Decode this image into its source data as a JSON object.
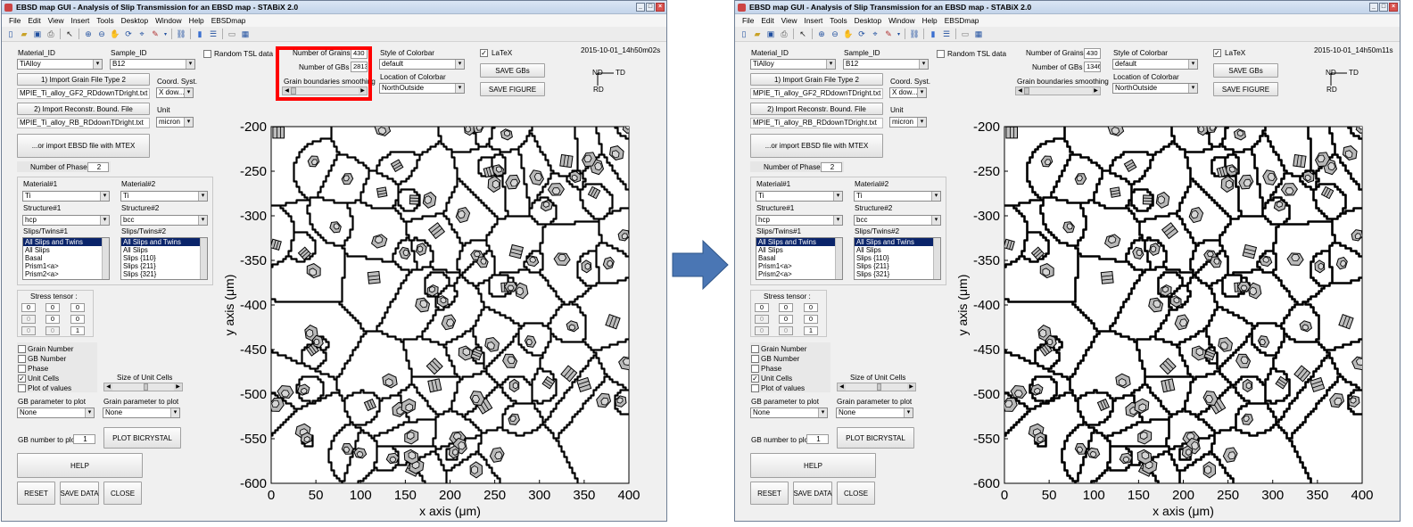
{
  "arrow_color": "#4a76b4",
  "highlight_color": "#ff0000",
  "windows": [
    {
      "title": "EBSD map GUI - Analysis of Slip Transmission for an EBSD map -  STABiX 2.0",
      "menu": [
        "File",
        "Edit",
        "View",
        "Insert",
        "Tools",
        "Desktop",
        "Window",
        "Help",
        "EBSDmap"
      ],
      "material_id_label": "Material_ID",
      "material_id_value": "TiAlloy",
      "sample_id_label": "Sample_ID",
      "sample_id_value": "B12",
      "random_tsl_label": "Random TSL data",
      "num_grains_label": "Number of Grains :",
      "num_grains_value": "430",
      "num_gbs_label": "Number of GBs :",
      "num_gbs_value": "2813",
      "gb_smoothing_label": "Grain boundaries smoothing",
      "colorbar_style_label": "Style of Colorbar",
      "colorbar_style_value": "default",
      "colorbar_location_label": "Location of Colorbar",
      "colorbar_location_value": "NorthOutside",
      "latex_label": "LaTeX",
      "save_gbs_label": "SAVE GBs",
      "save_figure_label": "SAVE FIGURE",
      "timestamp": "2015-10-01_14h50m02s",
      "import_grain_label": "1) Import Grain File Type 2",
      "grain_file": "MPIE_Ti_alloy_GF2_RDdownTDright.txt",
      "coord_syst_label": "Coord. Syst.",
      "coord_syst_value": "X dow...",
      "import_rb_label": "2) Import Reconstr. Bound. File",
      "rb_file": "MPIE_Ti_alloy_RB_RDdownTDright.txt",
      "unit_label": "Unit",
      "unit_value": "micron",
      "mtex_label": "...or import EBSD file with MTEX",
      "num_phases_label": "Number of Phases",
      "num_phases_value": "2",
      "material1_label": "Material#1",
      "material1_value": "Ti",
      "structure1_label": "Structure#1",
      "structure1_value": "hcp",
      "slips1_label": "Slips/Twins#1",
      "slips1_items": [
        "All Slips and Twins",
        "All Slips",
        "Basal",
        "Prism1<a>",
        "Prism2<a>"
      ],
      "material2_label": "Material#2",
      "material2_value": "Ti",
      "structure2_label": "Structure#2",
      "structure2_value": "bcc",
      "slips2_label": "Slips/Twins#2",
      "slips2_items": [
        "All Slips and Twins",
        "All Slips",
        "Slips {110}",
        "Slips {211}",
        "Slips {321}"
      ],
      "stress_label": "Stress tensor :",
      "stress_values": [
        "0",
        "0",
        "0",
        "0",
        "0",
        "0",
        "0",
        "0",
        "1"
      ],
      "check_grain_number": "Grain Number",
      "check_gb_number": "GB Number",
      "check_phase": "Phase",
      "check_unit_cells": "Unit Cells",
      "check_plot_values": "Plot of values",
      "unit_cells_size_label": "Size of Unit Cells",
      "gb_param_label": "GB parameter to plot",
      "gb_param_value": "None",
      "grain_param_label": "Grain parameter to plot",
      "grain_param_value": "None",
      "gb_number_plot_label": "GB number to plot",
      "gb_number_plot_value": "1",
      "plot_bicrystal_label": "PLOT BICRYSTAL",
      "help_label": "HELP",
      "reset_label": "RESET",
      "save_data_label": "SAVE DATA",
      "close_label": "CLOSE",
      "axis_nd": "ND",
      "axis_td": "TD",
      "axis_rd": "RD",
      "plot_ylabel": "y axis (μm)",
      "plot_xlabel": "x axis (μm)",
      "plot_yticks": [
        "-200",
        "-250",
        "-300",
        "-350",
        "-400",
        "-450",
        "-500",
        "-550",
        "-600"
      ],
      "plot_xticks": [
        "0",
        "50",
        "100",
        "150",
        "200",
        "250",
        "300",
        "350",
        "400"
      ]
    },
    {
      "title": "EBSD map GUI - Analysis of Slip Transmission for an EBSD map -  STABiX 2.0",
      "menu": [
        "File",
        "Edit",
        "View",
        "Insert",
        "Tools",
        "Desktop",
        "Window",
        "Help",
        "EBSDmap"
      ],
      "material_id_label": "Material_ID",
      "material_id_value": "TiAlloy",
      "sample_id_label": "Sample_ID",
      "sample_id_value": "B12",
      "random_tsl_label": "Random TSL data",
      "num_grains_label": "Number of Grains :",
      "num_grains_value": "430",
      "num_gbs_label": "Number of GBs :",
      "num_gbs_value": "1346",
      "gb_smoothing_label": "Grain boundaries smoothing",
      "colorbar_style_label": "Style of Colorbar",
      "colorbar_style_value": "default",
      "colorbar_location_label": "Location of Colorbar",
      "colorbar_location_value": "NorthOutside",
      "latex_label": "LaTeX",
      "save_gbs_label": "SAVE GBs",
      "save_figure_label": "SAVE FIGURE",
      "timestamp": "2015-10-01_14h50m11s",
      "import_grain_label": "1) Import Grain File Type 2",
      "grain_file": "MPIE_Ti_alloy_GF2_RDdownTDright.txt",
      "coord_syst_label": "Coord. Syst.",
      "coord_syst_value": "X dow...",
      "import_rb_label": "2) Import Reconstr. Bound. File",
      "rb_file": "MPIE_Ti_alloy_RB_RDdownTDright.txt",
      "unit_label": "Unit",
      "unit_value": "micron",
      "mtex_label": "...or import EBSD file with MTEX",
      "num_phases_label": "Number of Phases",
      "num_phases_value": "2",
      "material1_label": "Material#1",
      "material1_value": "Ti",
      "structure1_label": "Structure#1",
      "structure1_value": "hcp",
      "slips1_label": "Slips/Twins#1",
      "slips1_items": [
        "All Slips and Twins",
        "All Slips",
        "Basal",
        "Prism1<a>",
        "Prism2<a>"
      ],
      "material2_label": "Material#2",
      "material2_value": "Ti",
      "structure2_label": "Structure#2",
      "structure2_value": "bcc",
      "slips2_label": "Slips/Twins#2",
      "slips2_items": [
        "All Slips and Twins",
        "All Slips",
        "Slips {110}",
        "Slips {211}",
        "Slips {321}"
      ],
      "stress_label": "Stress tensor :",
      "stress_values": [
        "0",
        "0",
        "0",
        "0",
        "0",
        "0",
        "0",
        "0",
        "1"
      ],
      "check_grain_number": "Grain Number",
      "check_gb_number": "GB Number",
      "check_phase": "Phase",
      "check_unit_cells": "Unit Cells",
      "check_plot_values": "Plot of values",
      "unit_cells_size_label": "Size of Unit Cells",
      "gb_param_label": "GB parameter to plot",
      "gb_param_value": "None",
      "grain_param_label": "Grain parameter to plot",
      "grain_param_value": "None",
      "gb_number_plot_label": "GB number to plot",
      "gb_number_plot_value": "1",
      "plot_bicrystal_label": "PLOT BICRYSTAL",
      "help_label": "HELP",
      "reset_label": "RESET",
      "save_data_label": "SAVE DATA",
      "close_label": "CLOSE",
      "axis_nd": "ND",
      "axis_td": "TD",
      "axis_rd": "RD",
      "plot_ylabel": "y axis (μm)",
      "plot_xlabel": "x axis (μm)",
      "plot_yticks": [
        "-200",
        "-250",
        "-300",
        "-350",
        "-400",
        "-450",
        "-500",
        "-550",
        "-600"
      ],
      "plot_xticks": [
        "0",
        "50",
        "100",
        "150",
        "200",
        "250",
        "300",
        "350",
        "400"
      ]
    }
  ]
}
